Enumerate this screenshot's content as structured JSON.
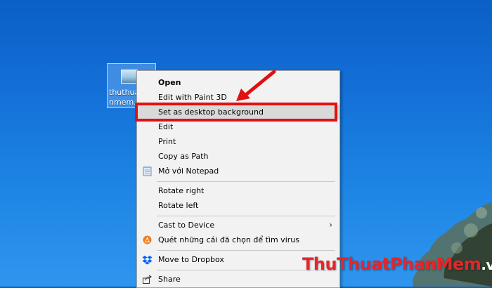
{
  "desktop": {
    "icon_filename": "thuthuatphanmem.\nnmem.",
    "icon_label_line1": "thuthua",
    "icon_label_line2": "nmem."
  },
  "menu": {
    "items": [
      {
        "label": "Open"
      },
      {
        "label": "Edit with Paint 3D"
      },
      {
        "label": "Set as desktop background"
      },
      {
        "label": "Edit"
      },
      {
        "label": "Print"
      },
      {
        "label": "Copy as Path"
      },
      {
        "label": "Mở với Notepad"
      },
      {
        "label": "Rotate right"
      },
      {
        "label": "Rotate left"
      },
      {
        "label": "Cast to Device"
      },
      {
        "label": "Quét những cái đã chọn để tìm virus"
      },
      {
        "label": "Move to Dropbox"
      },
      {
        "label": "Share"
      }
    ],
    "highlighted_item": "Set as desktop background",
    "submenu_indicator": "›"
  },
  "watermark": {
    "part1": "ThuThuat",
    "part2": "PhanMem",
    "part3": ".vn"
  },
  "colors": {
    "desktop_blue": "#136fd6",
    "annotation_red": "#e01010",
    "menu_bg": "#f2f2f2",
    "watermark_red": "#e3262b"
  },
  "icons": [
    "image-file-icon",
    "notepad-icon",
    "avast-icon",
    "dropbox-icon",
    "share-icon",
    "chevron-right-icon",
    "annotation-arrow"
  ]
}
